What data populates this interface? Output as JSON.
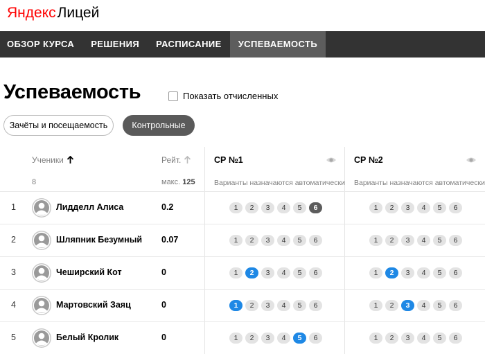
{
  "logo": {
    "brand": "Яндекс",
    "product": "Лицей"
  },
  "nav": [
    {
      "label": "ОБЗОР КУРСА",
      "active": false,
      "name": "nav-course-overview"
    },
    {
      "label": "РЕШЕНИЯ",
      "active": false,
      "name": "nav-solutions"
    },
    {
      "label": "РАСПИСАНИЕ",
      "active": false,
      "name": "nav-schedule"
    },
    {
      "label": "УСПЕВАЕМОСТЬ",
      "active": true,
      "name": "nav-progress"
    }
  ],
  "page": {
    "title": "Успеваемость",
    "show_expelled_label": "Показать отчисленных",
    "show_expelled_checked": false
  },
  "tabs": {
    "attendance_label": "Зачёты и посещаемость",
    "tests_label": "Контрольные"
  },
  "table": {
    "students_header": "Ученики",
    "students_sort_icon": "arrow-up-icon",
    "students_count": "8",
    "rating_header": "Рейт.",
    "rating_sort_icon": "arrow-up-icon",
    "rating_max_label": "макс.",
    "rating_max_value": "125",
    "tests": [
      {
        "title": "СР №1",
        "subtitle": "Варианты назначаются автоматически",
        "icon": "eye-icon"
      },
      {
        "title": "СР №2",
        "subtitle": "Варианты назначаются автоматически",
        "icon": "eye-icon"
      }
    ],
    "variant_labels": [
      "1",
      "2",
      "3",
      "4",
      "5",
      "6"
    ],
    "rows": [
      {
        "num": "1",
        "name": "Лидделл Алиса",
        "rating": "0.2",
        "t1": 6,
        "t1_style": "dark",
        "t2": null,
        "t2_style": null
      },
      {
        "num": "2",
        "name": "Шляпник Безумный",
        "rating": "0.07",
        "t1": null,
        "t1_style": null,
        "t2": null,
        "t2_style": null
      },
      {
        "num": "3",
        "name": "Чеширский Кот",
        "rating": "0",
        "t1": 2,
        "t1_style": "blue",
        "t2": 2,
        "t2_style": "blue"
      },
      {
        "num": "4",
        "name": "Мартовский Заяц",
        "rating": "0",
        "t1": 1,
        "t1_style": "blue",
        "t2": 3,
        "t2_style": "blue"
      },
      {
        "num": "5",
        "name": "Белый Кролик",
        "rating": "0",
        "t1": 5,
        "t1_style": "blue",
        "t2": null,
        "t2_style": null
      }
    ]
  },
  "colors": {
    "nav_bg": "#333333",
    "nav_active": "#5d5d5d",
    "brand_red": "#ff0000",
    "chip_blue": "#1e88e5",
    "chip_dark": "#5c5c5c"
  }
}
